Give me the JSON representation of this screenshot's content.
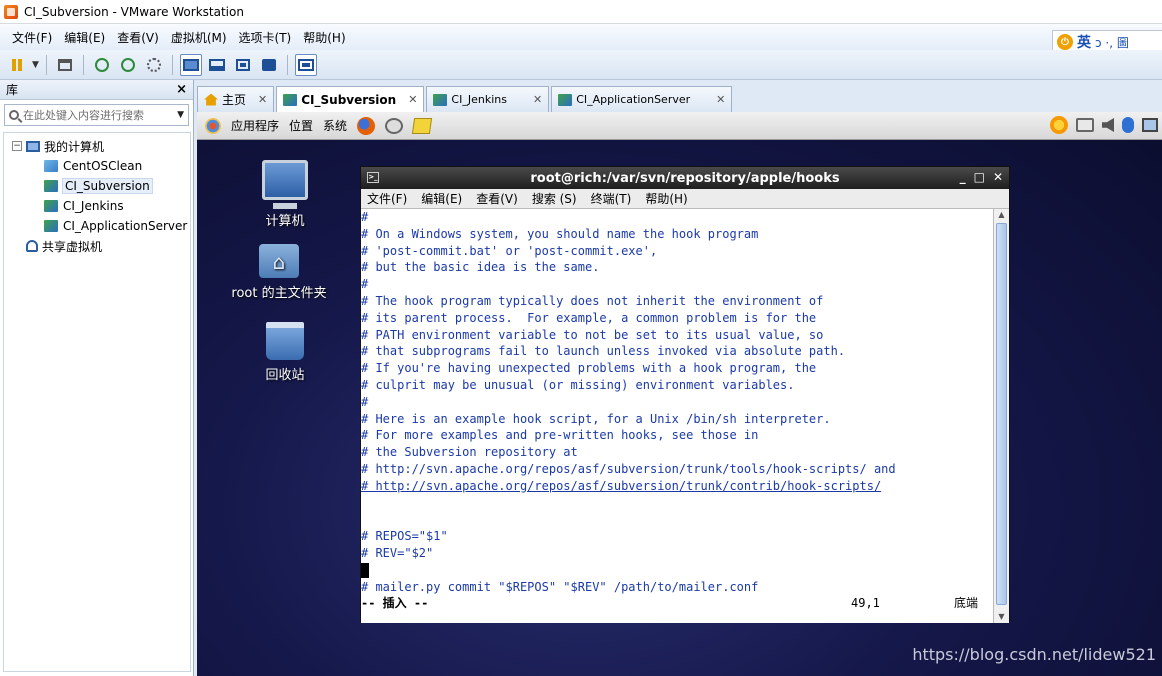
{
  "window": {
    "title": "CI_Subversion - VMware Workstation"
  },
  "menubar": {
    "items": [
      "文件(F)",
      "编辑(E)",
      "查看(V)",
      "虚拟机(M)",
      "选项卡(T)",
      "帮助(H)"
    ]
  },
  "ime": {
    "lang": "英",
    "symbols": "ɔ ·, 圖"
  },
  "library": {
    "title": "库",
    "close": "×",
    "search_placeholder": "在此处键入内容进行搜索",
    "tree": {
      "root": "我的计算机",
      "vms": [
        "CentOSClean",
        "CI_Subversion",
        "CI_Jenkins",
        "CI_ApplicationServer"
      ],
      "shared": "共享虚拟机"
    }
  },
  "tabs": [
    {
      "label": "主页",
      "icon": "home-icon"
    },
    {
      "label": "CI_Subversion",
      "icon": "vm-icon"
    },
    {
      "label": "CI_Jenkins",
      "icon": "vm-icon"
    },
    {
      "label": "CI_ApplicationServer",
      "icon": "vm-icon"
    }
  ],
  "gnome_panel": {
    "apps": "应用程序",
    "places": "位置",
    "system": "系统"
  },
  "desktop": {
    "computer": "计算机",
    "home": "root 的主文件夹",
    "trash": "回收站"
  },
  "terminal": {
    "title": "root@rich:/var/svn/repository/apple/hooks",
    "menu": [
      "文件(F)",
      "编辑(E)",
      "查看(V)",
      "搜索 (S)",
      "终端(T)",
      "帮助(H)"
    ],
    "lines": [
      "#",
      "# On a Windows system, you should name the hook program",
      "# 'post-commit.bat' or 'post-commit.exe',",
      "# but the basic idea is the same.",
      "#",
      "# The hook program typically does not inherit the environment of",
      "# its parent process.  For example, a common problem is for the",
      "# PATH environment variable to not be set to its usual value, so",
      "# that subprograms fail to launch unless invoked via absolute path.",
      "# If you're having unexpected problems with a hook program, the",
      "# culprit may be unusual (or missing) environment variables.",
      "#",
      "# Here is an example hook script, for a Unix /bin/sh interpreter.",
      "# For more examples and pre-written hooks, see those in",
      "# the Subversion repository at",
      "# http://svn.apache.org/repos/asf/subversion/trunk/tools/hook-scripts/ and",
      "# http://svn.apache.org/repos/asf/subversion/trunk/contrib/hook-scripts/",
      "",
      "",
      "# REPOS=\"$1\"",
      "# REV=\"$2\"",
      "",
      "# mailer.py commit \"$REPOS\" \"$REV\" /path/to/mailer.conf"
    ],
    "status_mode": "-- 插入 --",
    "status_pos": "49,1",
    "status_where": "底端"
  },
  "watermark": "https://blog.csdn.net/lidew521"
}
